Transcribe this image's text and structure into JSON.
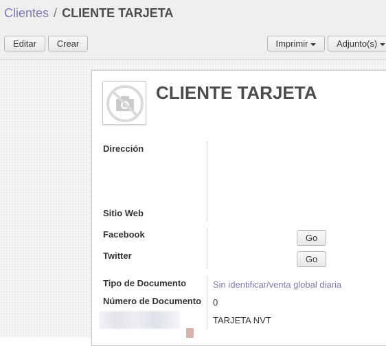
{
  "breadcrumb": {
    "parent": "Clientes",
    "separator": "/",
    "current": "CLIENTE TARJETA"
  },
  "toolbar": {
    "edit_label": "Editar",
    "create_label": "Crear",
    "print_label": "Imprimir",
    "attachments_label": "Adjunto(s)"
  },
  "record": {
    "name": "CLIENTE TARJETA",
    "fields": {
      "address_label": "Dirección",
      "website_label": "Sitio Web",
      "facebook_label": "Facebook",
      "twitter_label": "Twitter",
      "go_label": "Go",
      "doc_type_label": "Tipo de Documento",
      "doc_type_value": "Sin identificar/venta global diaria",
      "doc_number_label": "Número de Documento",
      "doc_number_value": "0",
      "extra_value": "TARJETA NVT"
    }
  },
  "colors": {
    "link": "#7c7bad",
    "title": "#4c4c4c",
    "panel_bg": "#f0eeee"
  },
  "icons": {
    "avatar": "no-image-camera-icon",
    "print_caret": "caret-down-icon",
    "attachments_caret": "caret-down-icon"
  }
}
